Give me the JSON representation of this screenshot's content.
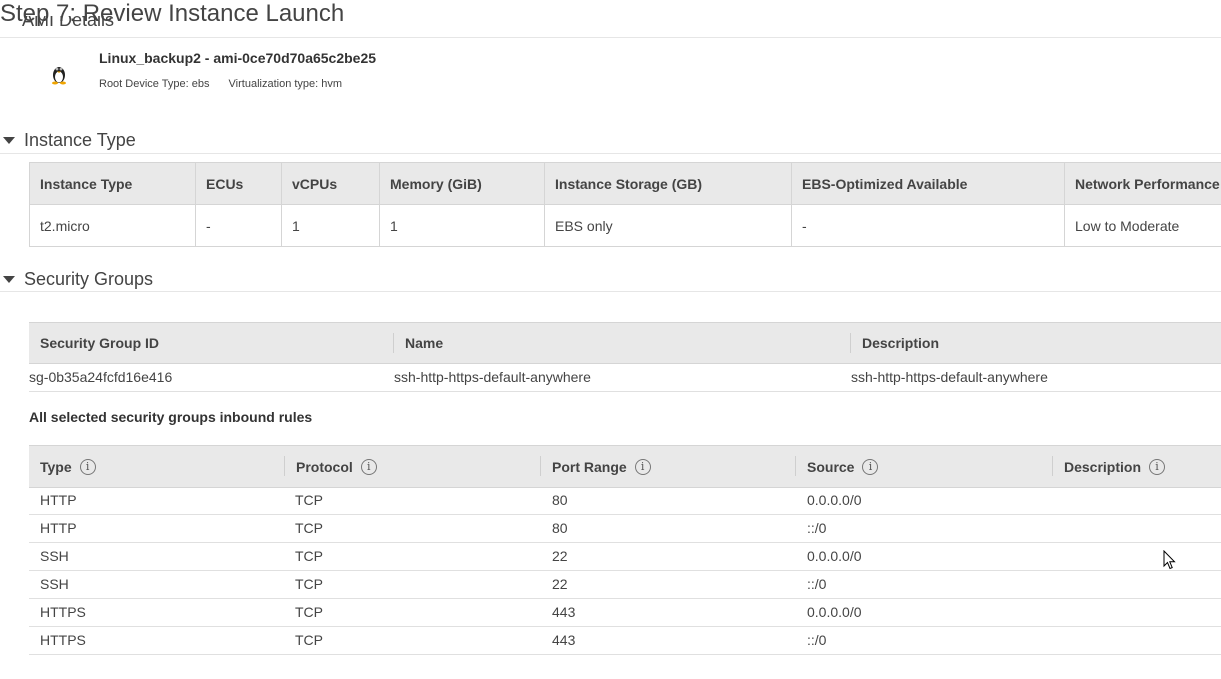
{
  "page_title": "Step 7: Review Instance Launch",
  "ami_section": {
    "title": "AMI Details",
    "icon": "linux-penguin-icon",
    "ami_name": "Linux_backup2 - ami-0ce70d70a65c2be25",
    "root_device": "Root Device Type: ebs",
    "virtualization": "Virtualization type: hvm"
  },
  "instance_type_section": {
    "title": "Instance Type",
    "headers": [
      "Instance Type",
      "ECUs",
      "vCPUs",
      "Memory (GiB)",
      "Instance Storage (GB)",
      "EBS-Optimized Available",
      "Network Performance"
    ],
    "row": [
      "t2.micro",
      "-",
      "1",
      "1",
      "EBS only",
      "-",
      "Low to Moderate"
    ]
  },
  "security_groups_section": {
    "title": "Security Groups",
    "headers": [
      "Security Group ID",
      "Name",
      "Description"
    ],
    "row": [
      "sg-0b35a24fcfd16e416",
      "ssh-http-https-default-anywhere",
      "ssh-http-https-default-anywhere"
    ],
    "inbound_title": "All selected security groups inbound rules",
    "inbound_headers": [
      "Type",
      "Protocol",
      "Port Range",
      "Source",
      "Description"
    ],
    "inbound_rows": [
      [
        "HTTP",
        "TCP",
        "80",
        "0.0.0.0/0",
        ""
      ],
      [
        "HTTP",
        "TCP",
        "80",
        "::/0",
        ""
      ],
      [
        "SSH",
        "TCP",
        "22",
        "0.0.0.0/0",
        ""
      ],
      [
        "SSH",
        "TCP",
        "22",
        "::/0",
        ""
      ],
      [
        "HTTPS",
        "TCP",
        "443",
        "0.0.0.0/0",
        ""
      ],
      [
        "HTTPS",
        "TCP",
        "443",
        "::/0",
        ""
      ]
    ]
  },
  "colors": {
    "header_bg": "#e9e9e9",
    "text": "#444444"
  }
}
